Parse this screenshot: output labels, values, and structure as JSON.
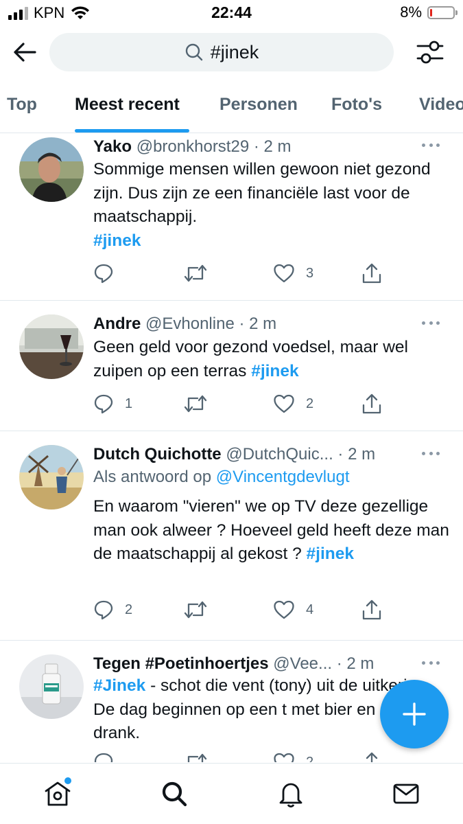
{
  "status_bar": {
    "carrier": "KPN",
    "time": "22:44",
    "battery_percent": "8%",
    "battery_level": 0.08,
    "battery_color": "#e0241b",
    "signal_bars": 4,
    "signal_bars_filled": 3
  },
  "search": {
    "query": "#jinek",
    "icon": "search-icon"
  },
  "tabs": [
    {
      "label": "Top",
      "active": false
    },
    {
      "label": "Meest recent",
      "active": true
    },
    {
      "label": "Personen",
      "active": false
    },
    {
      "label": "Foto's",
      "active": false
    },
    {
      "label": "Video",
      "active": false
    }
  ],
  "accent_color": "#1d9bf0",
  "tweets": [
    {
      "name": "Yako",
      "handle": "@bronkhorst29",
      "time": "· 2 m",
      "text": "Sommige mensen willen gewoon niet gezond zijn. Dus zijn ze een financiële last voor de maatschappij.",
      "hashtag": "#jinek",
      "replies": "",
      "retweets": "",
      "likes": "3"
    },
    {
      "name": "Andre",
      "handle": "@Evhonline",
      "time": "· 2 m",
      "text": "Geen geld voor gezond voedsel, maar wel zuipen op een terras ",
      "hashtag": "#jinek",
      "replies": "1",
      "retweets": "",
      "likes": "2"
    },
    {
      "name": "Dutch Quichotte",
      "handle": "@DutchQuic...",
      "time": "· 2 m",
      "reply_prefix": "Als antwoord op ",
      "reply_to": "@Vincentgdevlugt",
      "text": "En waarom \"vieren\" we op TV deze gezellige man ook alweer ? Hoeveel geld heeft deze man de maatschappij al gekost ? ",
      "hashtag": "#jinek",
      "replies": "2",
      "retweets": "",
      "likes": "4"
    },
    {
      "name": "Tegen #Poetinhoertjes",
      "handle": "@Vee...",
      "time": "· 2 m",
      "hashtag": "#Jinek",
      "text": " - schot die vent (tony) uit de uitkering. De dag beginnen op een t met bier en sterke drank.",
      "replies": "",
      "retweets": "",
      "likes": "2"
    }
  ],
  "bottom_nav": [
    {
      "icon": "home-icon",
      "has_notification_dot": true
    },
    {
      "icon": "search-icon",
      "active": true
    },
    {
      "icon": "bell-icon"
    },
    {
      "icon": "mail-icon"
    }
  ],
  "fab_icon": "compose-plus-icon"
}
